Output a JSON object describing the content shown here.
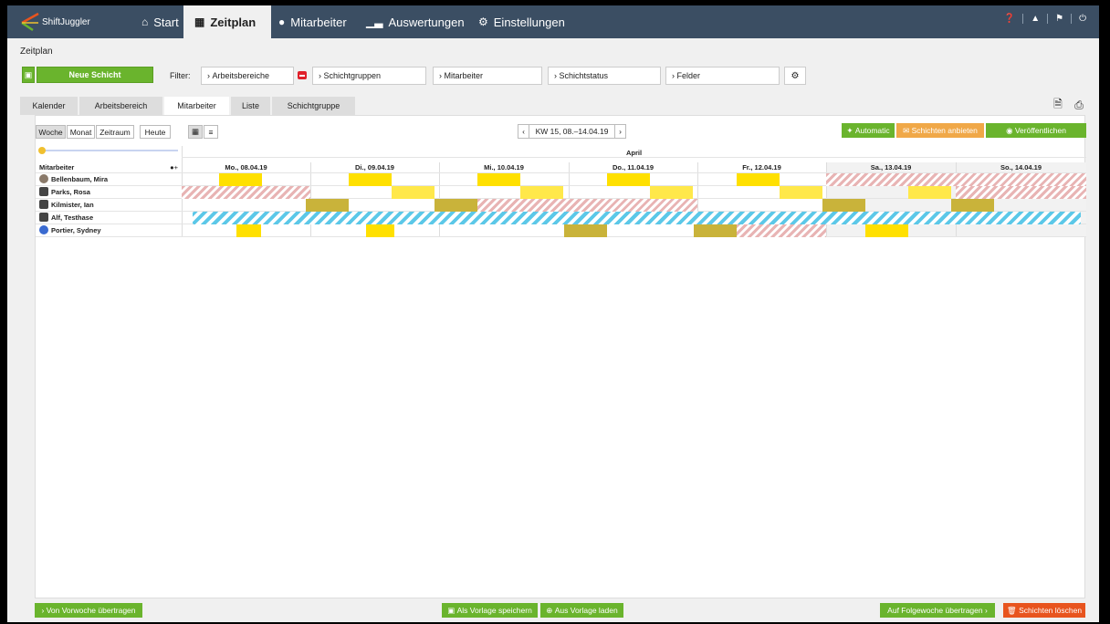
{
  "app": {
    "logo_text": "ShiftJuggler"
  },
  "nav": {
    "start": "Start",
    "zeitplan": "Zeitplan",
    "mitarbeiter": "Mitarbeiter",
    "auswertungen": "Auswertungen",
    "einstellungen": "Einstellungen"
  },
  "page": {
    "title": "Zeitplan"
  },
  "toolbar": {
    "new_shift": "Neue Schicht",
    "filter_label": "Filter:",
    "filters": [
      "Arbeitsbereiche",
      "Schichtgruppen",
      "Mitarbeiter",
      "Schichtstatus",
      "Felder"
    ]
  },
  "tabs": [
    "Kalender",
    "Arbeitsbereich",
    "Mitarbeiter",
    "Liste",
    "Schichtgruppe"
  ],
  "view_buttons": [
    "Woche",
    "Monat",
    "Zeitraum",
    "Heute"
  ],
  "week_selector": "KW 15, 08.–14.04.19",
  "actions": {
    "automatic": "Automatic",
    "offer": "Schichten anbieten",
    "publish": "Veröffentlichen"
  },
  "grid": {
    "month": "April",
    "column_header": "Mitarbeiter",
    "days": [
      "Mo., 08.04.19",
      "Di., 09.04.19",
      "Mi., 10.04.19",
      "Do., 11.04.19",
      "Fr., 12.04.19",
      "Sa., 13.04.19",
      "So., 14.04.19"
    ],
    "employees": [
      "Bellenbaum, Mira",
      "Parks, Rosa",
      "Kilmister, Ian",
      "Alf, Testhase",
      "Portier, Sydney"
    ]
  },
  "bottom": {
    "from_prev": "Von Vorwoche übertragen",
    "save_template": "Als Vorlage speichern",
    "load_template": "Aus Vorlage laden",
    "to_next": "Auf Folgewoche übertragen",
    "delete": "Schichten löschen"
  },
  "colors": {
    "nav_bg": "#3b4e63",
    "green": "#6ab42d",
    "orange": "#f0a848",
    "red": "#e8541e",
    "yellow": "#ffe000",
    "olive": "#c9b33a",
    "pale_yellow": "#ffe84a"
  }
}
